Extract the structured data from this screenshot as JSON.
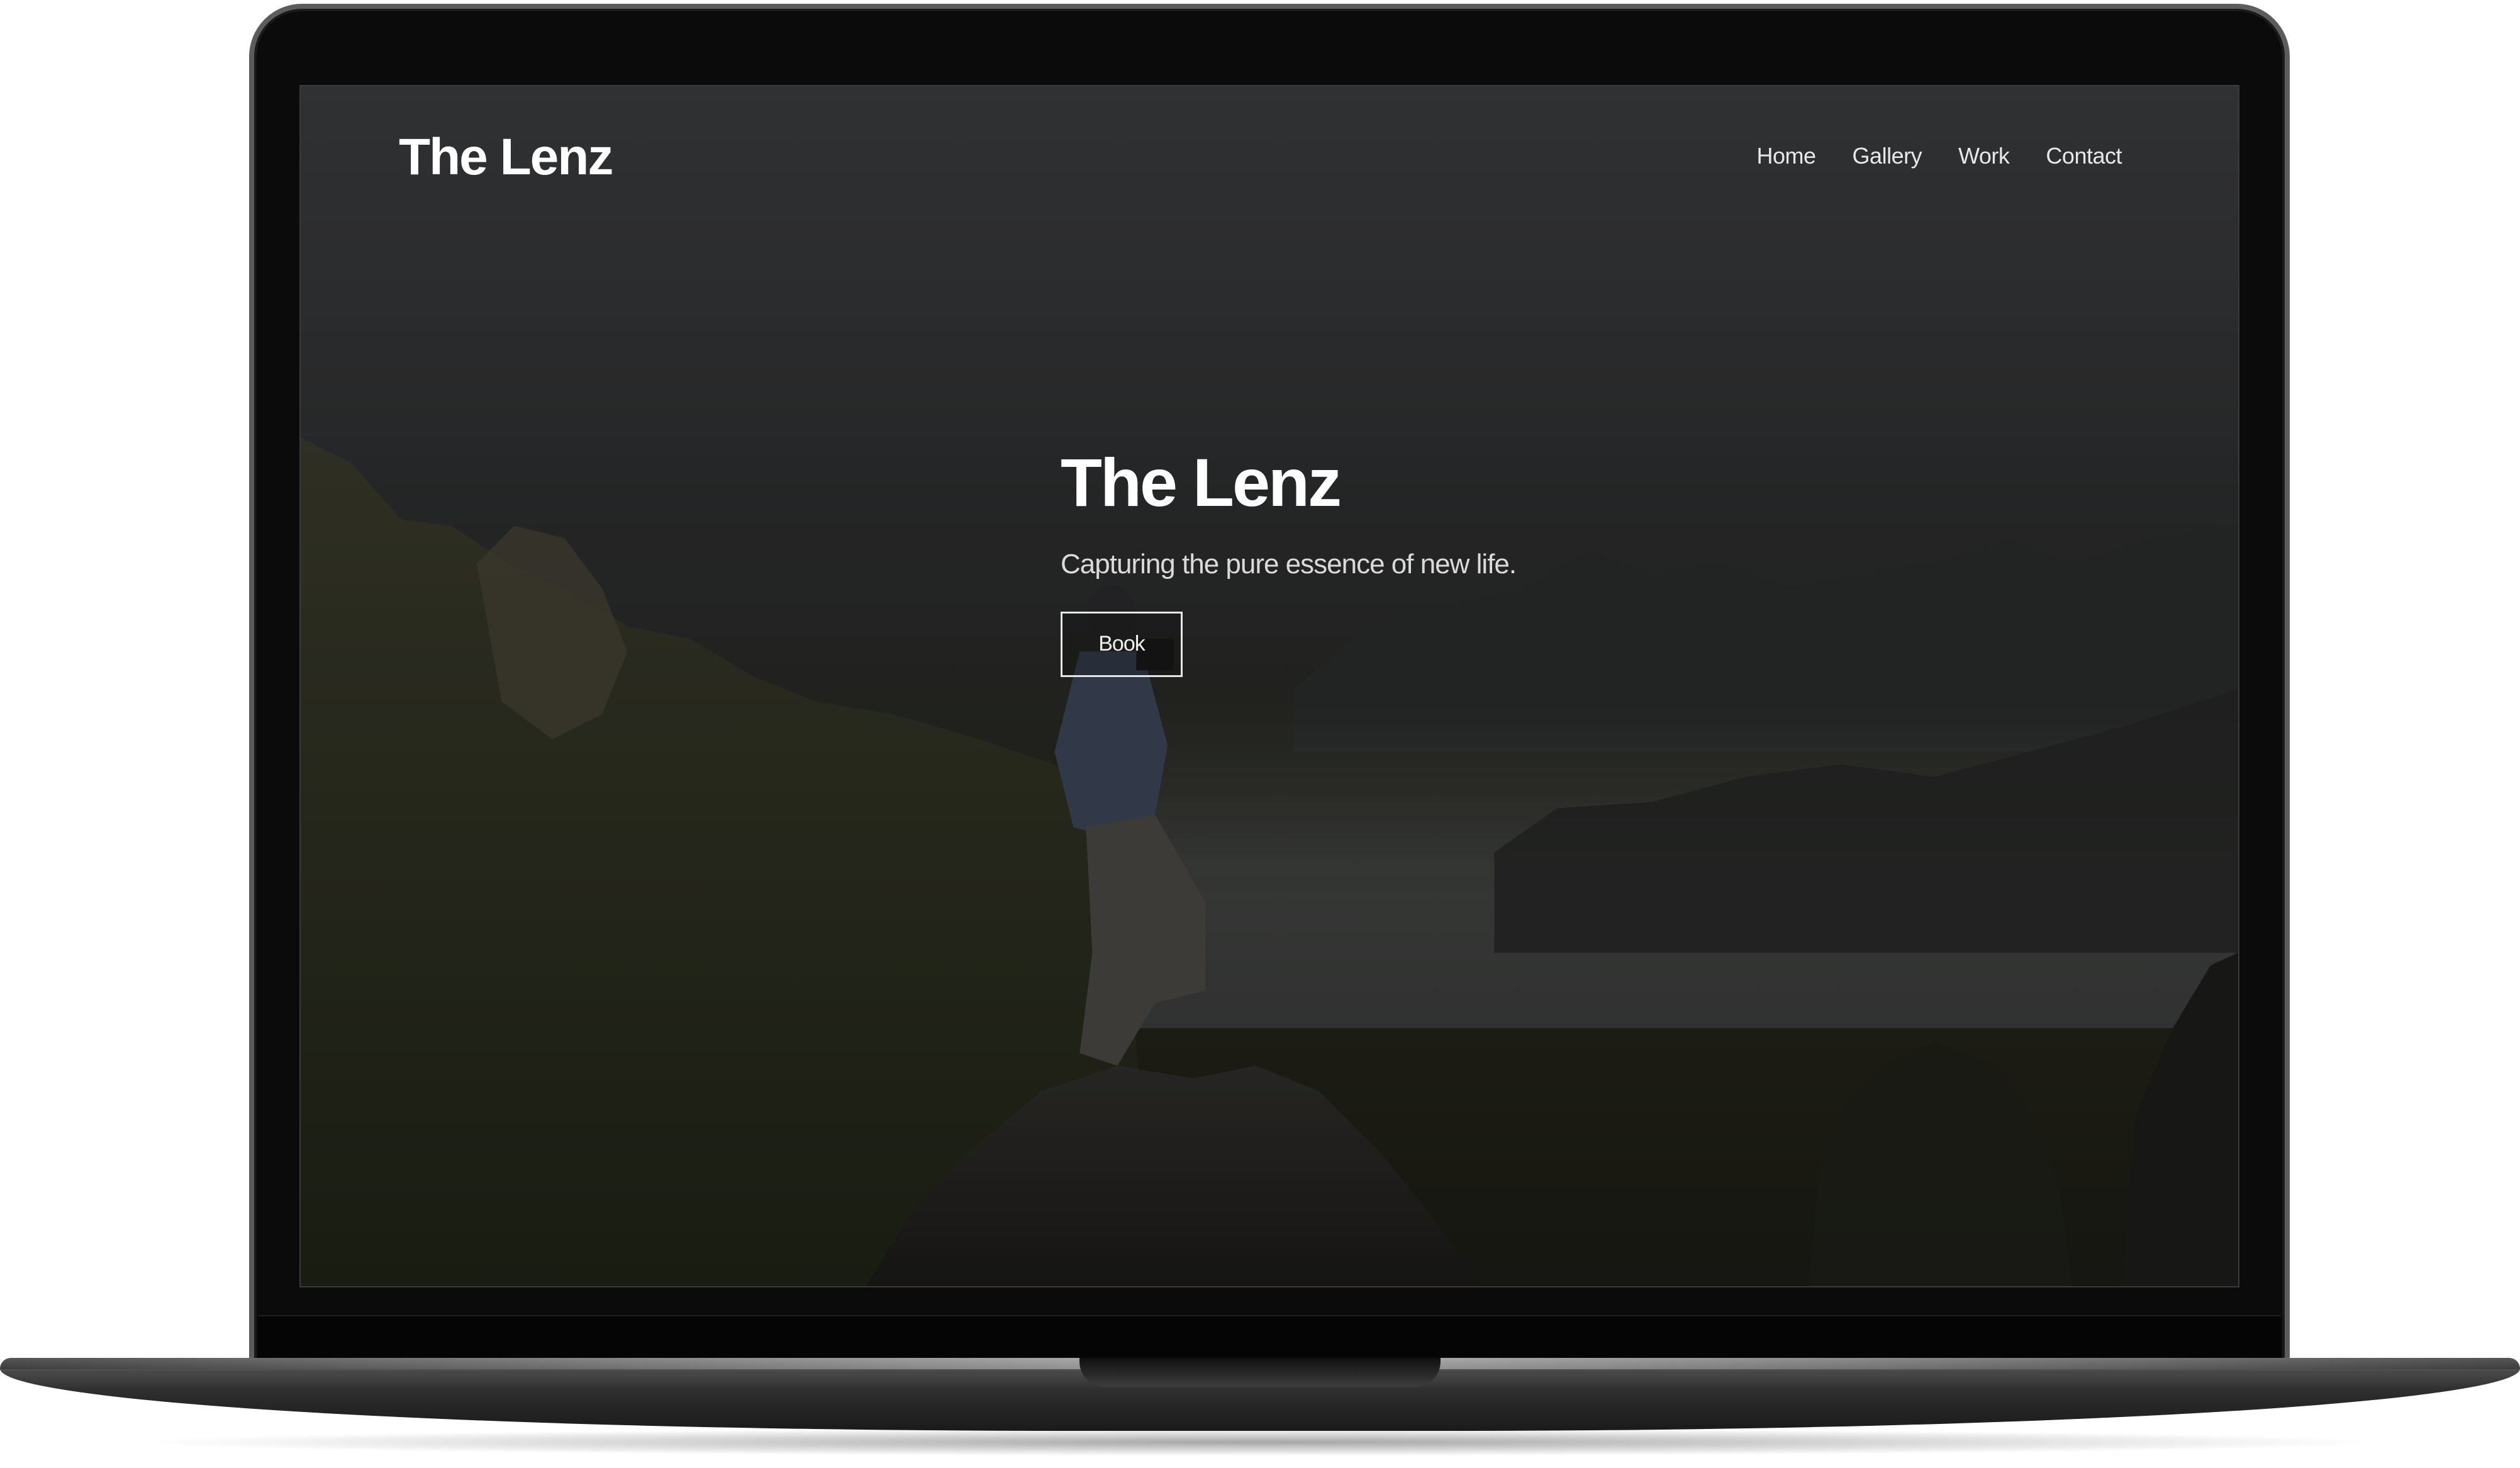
{
  "site": {
    "logo": "The Lenz",
    "nav": [
      "Home",
      "Gallery",
      "Work",
      "Contact"
    ]
  },
  "hero": {
    "title": "The Lenz",
    "tagline": "Capturing the pure essence of new life.",
    "button_label": "Book"
  },
  "colors": {
    "text_primary": "#ffffff",
    "text_secondary": "#dadada",
    "laptop_bezel": "#0b0b0b"
  }
}
